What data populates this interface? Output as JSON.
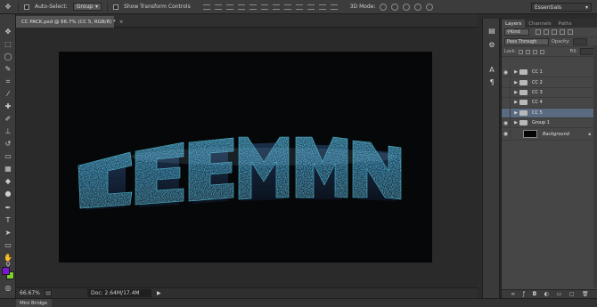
{
  "options_bar": {
    "auto_select_label": "Auto-Select:",
    "auto_select_value": "Group",
    "show_transform_label": "Show Transform Controls",
    "mode_3d_label": "3D Mode:",
    "workspace": "Essentials"
  },
  "document": {
    "tab_title": "CC PACK.psd @ 66.7% (CC 5, RGB/8) *",
    "tab_close": "×"
  },
  "status": {
    "zoom": "66.67%",
    "doc_info": "Doc: 2.64M/17.4M"
  },
  "bottom": {
    "mini_bridge": "Mini Bridge"
  },
  "panel": {
    "tabs": [
      "Layers",
      "Channels",
      "Paths"
    ],
    "kind_label": "Kind",
    "blend_mode": "Pass Through",
    "opacity_label": "Opacity:",
    "lock_label": "Lock:",
    "fill_label": "Fill:"
  },
  "layers": [
    {
      "name": "CC 1",
      "visible": true,
      "selected": false
    },
    {
      "name": "CC 2",
      "visible": false,
      "selected": false
    },
    {
      "name": "CC 3",
      "visible": false,
      "selected": false
    },
    {
      "name": "CC 4",
      "visible": false,
      "selected": false
    },
    {
      "name": "CC 5",
      "visible": false,
      "selected": true
    },
    {
      "name": "Group 1",
      "visible": true,
      "selected": false
    },
    {
      "name": "Background",
      "visible": true,
      "selected": false
    }
  ],
  "colors": {
    "foreground": "#7c17d1",
    "background": "#7bd12e",
    "canvas": "#060708",
    "selection": "#5a6a80"
  },
  "icons": {
    "eye": "eye-icon",
    "folder": "folder-icon",
    "lock": "lock-icon"
  }
}
